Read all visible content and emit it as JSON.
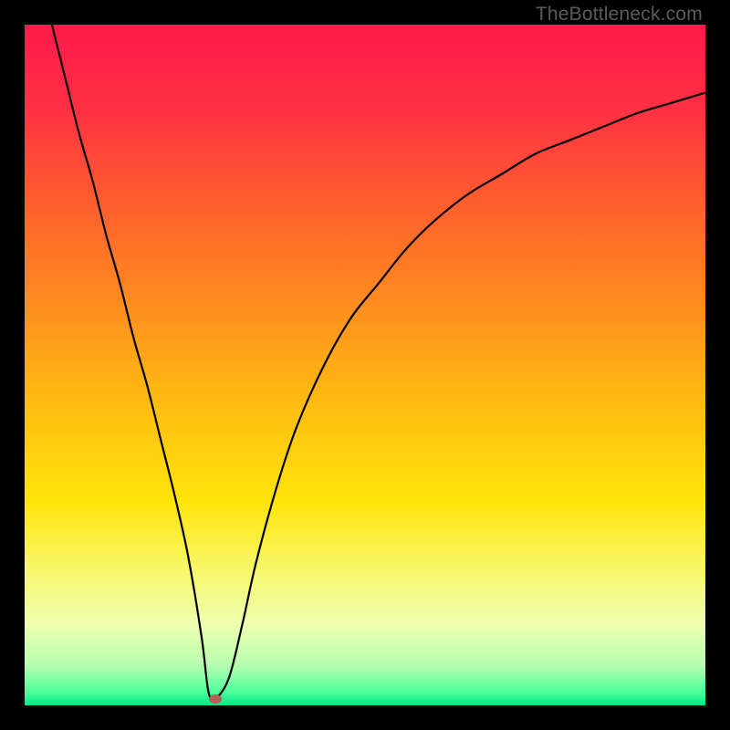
{
  "watermark": {
    "text": "TheBottleneck.com"
  },
  "chart_data": {
    "type": "line",
    "title": "",
    "xlabel": "",
    "ylabel": "",
    "xlim": [
      0,
      100
    ],
    "ylim": [
      0,
      100
    ],
    "gradient_stops": [
      {
        "offset": 0,
        "color": "#ff1a4b"
      },
      {
        "offset": 12,
        "color": "#ff2f44"
      },
      {
        "offset": 25,
        "color": "#ff5a30"
      },
      {
        "offset": 40,
        "color": "#ff8a20"
      },
      {
        "offset": 55,
        "color": "#ffba12"
      },
      {
        "offset": 70,
        "color": "#ffe40a"
      },
      {
        "offset": 80,
        "color": "#f7f76a"
      },
      {
        "offset": 88,
        "color": "#efffb0"
      },
      {
        "offset": 94,
        "color": "#b8ffb0"
      },
      {
        "offset": 98,
        "color": "#4fff9a"
      },
      {
        "offset": 100,
        "color": "#00e88a"
      }
    ],
    "series": [
      {
        "name": "bottleneck-curve",
        "x": [
          4,
          6,
          8,
          10,
          12,
          14,
          16,
          18,
          20,
          22,
          24,
          26,
          27,
          28,
          30,
          32,
          34,
          37,
          40,
          44,
          48,
          52,
          56,
          60,
          65,
          70,
          75,
          80,
          85,
          90,
          95,
          100
        ],
        "y": [
          100,
          92,
          84,
          77,
          69,
          62,
          54,
          47,
          39,
          31,
          22,
          10,
          2,
          1,
          4,
          12,
          21,
          32,
          41,
          50,
          57,
          62,
          67,
          71,
          75,
          78,
          81,
          83,
          85,
          87,
          88.5,
          90
        ]
      }
    ],
    "marker": {
      "x": 28,
      "y": 1,
      "color": "#b46056"
    }
  }
}
